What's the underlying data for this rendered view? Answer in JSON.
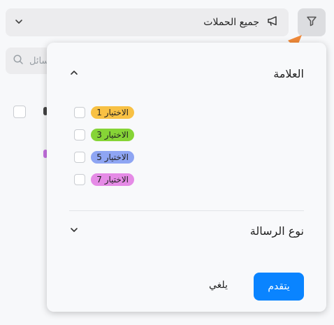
{
  "campaign_select": {
    "value": "جميع الحملات",
    "icon": "megaphone-icon",
    "chevron": "chevron-down-icon"
  },
  "filter_button": {
    "icon": "filter-icon"
  },
  "search": {
    "placeholder": "سائل"
  },
  "filter_panel": {
    "tag_section": {
      "title": "العلامة",
      "expanded": true,
      "options": [
        {
          "label": "الاختيار 1",
          "color": "#f8c144"
        },
        {
          "label": "الاختيار 3",
          "color": "#86d436"
        },
        {
          "label": "الاختيار 5",
          "color": "#8ea5f3"
        },
        {
          "label": "الاختيار 7",
          "color": "#e58be6"
        }
      ]
    },
    "message_type_section": {
      "title": "نوع الرسالة",
      "expanded": false
    },
    "cancel_label": "يلغي",
    "apply_label": "يتقدم"
  },
  "colors": {
    "accent": "#0a84ff",
    "annotation_arrow": "#f08a3a"
  }
}
